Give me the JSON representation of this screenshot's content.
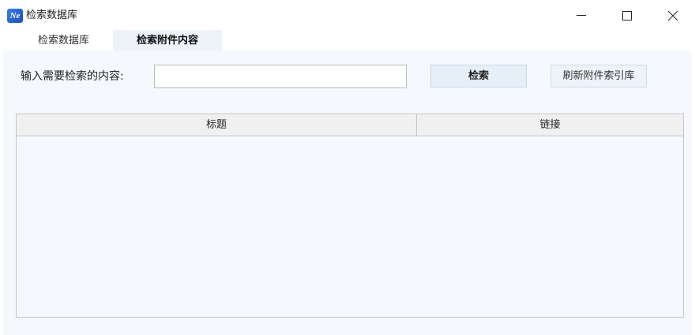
{
  "window": {
    "title": "检索数据库",
    "icon": "app-logo-icon",
    "icon_text": "Ne",
    "controls": [
      "minimize-icon",
      "maximize-icon",
      "close-icon"
    ]
  },
  "tabs": [
    {
      "label": "检索数据库",
      "active": false
    },
    {
      "label": "检索附件内容",
      "active": true
    }
  ],
  "search": {
    "label": "输入需要检索的内容:",
    "value": "",
    "placeholder": "",
    "search_button": "检索",
    "refresh_button": "刷新附件索引库"
  },
  "table": {
    "columns": [
      "标题",
      "链接"
    ],
    "rows": []
  },
  "colors": {
    "panel_bg": "#f5f8fc",
    "active_tab_bg": "#eef3fa",
    "button_bg": "#e6eef8",
    "border": "#c7c7c7"
  }
}
